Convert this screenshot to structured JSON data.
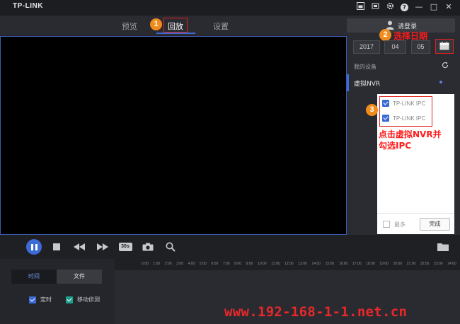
{
  "app": {
    "logo": "TP-LINK"
  },
  "window_icons": [
    "window-mode-icon",
    "fullscreen-icon",
    "gear-icon",
    "help-icon",
    "minimize-icon",
    "maximize-icon",
    "close-icon"
  ],
  "window_glyphs": {
    "help": "?",
    "minimize": "—",
    "maximize": "□",
    "close": "✕"
  },
  "tabs": [
    {
      "label": "预览",
      "active": false
    },
    {
      "label": "回放",
      "active": true
    },
    {
      "label": "设置",
      "active": false
    }
  ],
  "login": {
    "label": "请登录"
  },
  "date": {
    "year": "2017",
    "month": "04",
    "day": "05"
  },
  "devices": {
    "header": "我的设备",
    "items": [
      {
        "name": "虚拟NVR"
      }
    ]
  },
  "ipc_list": [
    {
      "label": "TP-LINK IPC",
      "checked": true
    },
    {
      "label": "TP-LINK IPC",
      "checked": true
    }
  ],
  "popup": {
    "most_label": "最多",
    "done_label": "完成"
  },
  "annotations": {
    "markers": [
      "1",
      "2",
      "3"
    ],
    "note_2": "选择日期",
    "note_3_line1": "点击虚拟NVR并",
    "note_3_line2": "勾选IPC"
  },
  "controls": {
    "clip_label": "30s"
  },
  "timeline": {
    "ticks": [
      "0:00",
      "1:00",
      "2:00",
      "3:00",
      "4:00",
      "5:00",
      "6:00",
      "7:00",
      "8:00",
      "9:00",
      "10:00",
      "11:00",
      "12:00",
      "13:00",
      "14:00",
      "15:00",
      "16:00",
      "17:00",
      "18:00",
      "19:00",
      "20:00",
      "21:00",
      "22:00",
      "23:00",
      "24:00"
    ]
  },
  "search": {
    "tab_time": "时间",
    "tab_file": "文件",
    "filter_timed": "定时",
    "filter_motion": "移动侦测"
  },
  "watermark": "www.192-168-1-1.net.cn",
  "colors": {
    "accent": "#3d6bd6",
    "annotation_red": "#e02020",
    "marker_orange": "#f08c1c"
  }
}
